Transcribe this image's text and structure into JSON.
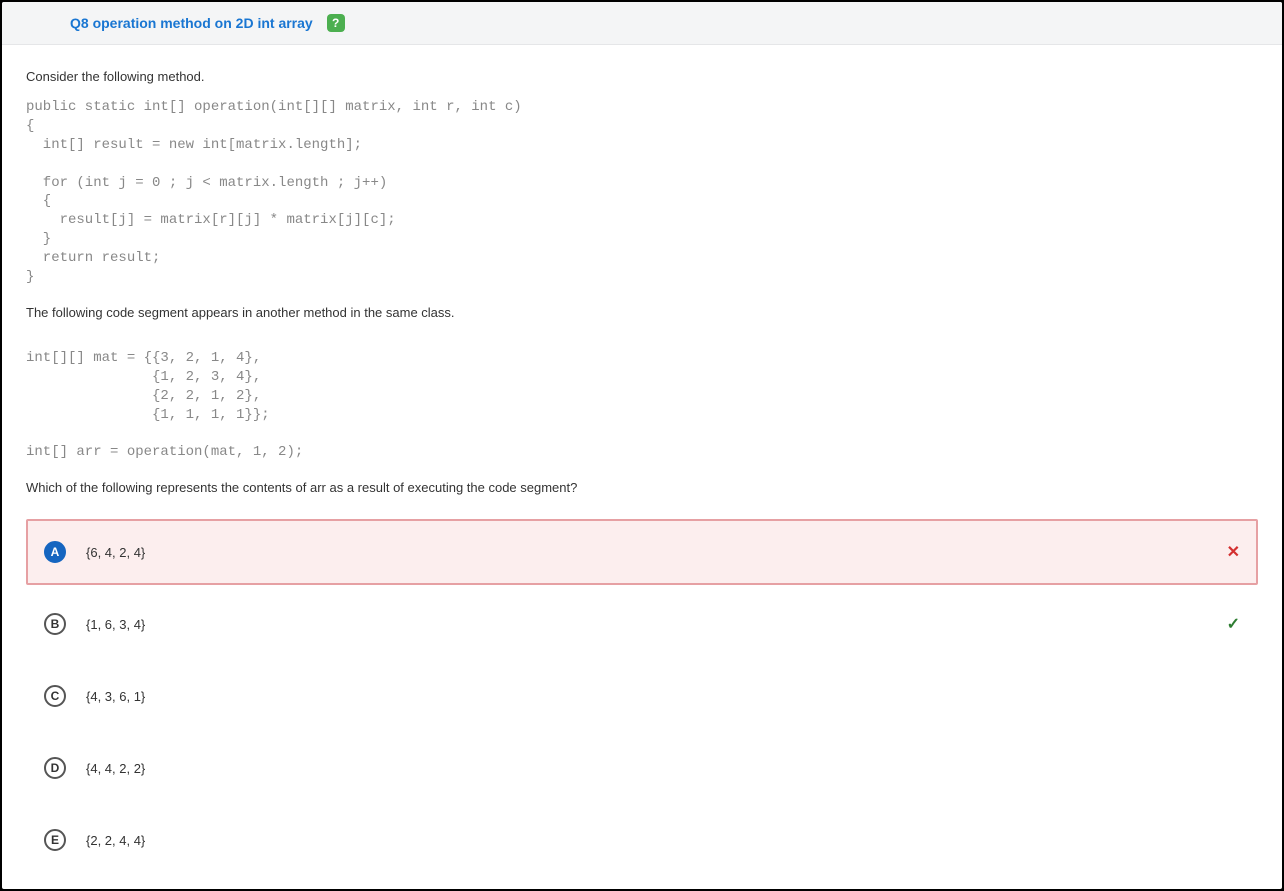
{
  "header": {
    "title": "Q8 operation method on 2D int array",
    "help_icon": "?"
  },
  "question": {
    "intro": "Consider the following method.",
    "code1": "public static int[] operation(int[][] matrix, int r, int c)\n{\n  int[] result = new int[matrix.length];\n\n  for (int j = 0 ; j < matrix.length ; j++)\n  {\n    result[j] = matrix[r][j] * matrix[j][c];\n  }\n  return result;\n}",
    "middle": "The following code segment appears in another method in the same class.",
    "code2": "int[][] mat = {{3, 2, 1, 4},\n               {1, 2, 3, 4},\n               {2, 2, 1, 2},\n               {1, 1, 1, 1}};\n\nint[] arr = operation(mat, 1, 2);",
    "final": "Which of the following represents the contents of arr as a result of executing the code segment?"
  },
  "answers": [
    {
      "letter": "A",
      "text": "{6, 4, 2, 4}",
      "selected": true,
      "correct": false
    },
    {
      "letter": "B",
      "text": "{1, 6, 3, 4}",
      "selected": false,
      "correct": true
    },
    {
      "letter": "C",
      "text": "{4, 3, 6, 1}",
      "selected": false,
      "correct": false
    },
    {
      "letter": "D",
      "text": "{4, 4, 2, 2}",
      "selected": false,
      "correct": false
    },
    {
      "letter": "E",
      "text": "{2, 2, 4, 4}",
      "selected": false,
      "correct": false
    }
  ],
  "icons": {
    "wrong": "✕",
    "correct": "✓"
  }
}
